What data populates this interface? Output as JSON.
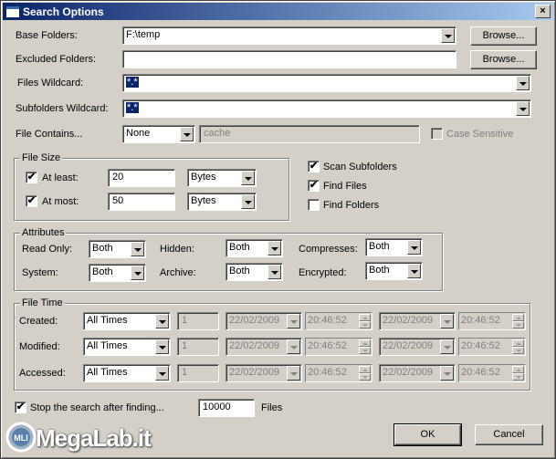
{
  "window": {
    "title": "Search Options",
    "close_glyph": "×"
  },
  "base_folders": {
    "label": "Base Folders:",
    "value": "F:\\temp",
    "browse": "Browse..."
  },
  "excluded_folders": {
    "label": "Excluded Folders:",
    "value": "",
    "browse": "Browse..."
  },
  "files_wildcard": {
    "label": "Files Wildcard:",
    "value": "*.*"
  },
  "subfolders_wildcard": {
    "label": "Subfolders Wildcard:",
    "value": "*.*"
  },
  "file_contains": {
    "label": "File Contains...",
    "mode": "None",
    "text": "cache",
    "case_sensitive": "Case Sensitive"
  },
  "file_size": {
    "title": "File Size",
    "at_least": {
      "label": "At least:",
      "value": "20",
      "unit": "Bytes",
      "checked": true
    },
    "at_most": {
      "label": "At most:",
      "value": "50",
      "unit": "Bytes",
      "checked": true
    }
  },
  "options": {
    "scan_subfolders": {
      "label": "Scan Subfolders",
      "checked": true
    },
    "find_files": {
      "label": "Find Files",
      "checked": true
    },
    "find_folders": {
      "label": "Find Folders",
      "checked": false
    }
  },
  "attributes": {
    "title": "Attributes",
    "read_only": {
      "label": "Read Only:",
      "value": "Both"
    },
    "hidden": {
      "label": "Hidden:",
      "value": "Both"
    },
    "compresses": {
      "label": "Compresses:",
      "value": "Both"
    },
    "system": {
      "label": "System:",
      "value": "Both"
    },
    "archive": {
      "label": "Archive:",
      "value": "Both"
    },
    "encrypted": {
      "label": "Encrypted:",
      "value": "Both"
    }
  },
  "file_time": {
    "title": "File Time",
    "rows": [
      {
        "label": "Created:",
        "mode": "All Times",
        "num": "1",
        "date1": "22/02/2009",
        "time1": "20:46:52",
        "date2": "22/02/2009",
        "time2": "20:46:52"
      },
      {
        "label": "Modified:",
        "mode": "All Times",
        "num": "1",
        "date1": "22/02/2009",
        "time1": "20:46:52",
        "date2": "22/02/2009",
        "time2": "20:46:52"
      },
      {
        "label": "Accessed:",
        "mode": "All Times",
        "num": "1",
        "date1": "22/02/2009",
        "time1": "20:46:52",
        "date2": "22/02/2009",
        "time2": "20:46:52"
      }
    ]
  },
  "stop_search": {
    "label": "Stop the search after finding...",
    "value": "10000",
    "suffix": "Files",
    "checked": true
  },
  "buttons": {
    "ok": "OK",
    "cancel": "Cancel"
  },
  "watermark": {
    "text": "MegaLab.it",
    "badge": "MLI"
  },
  "check_glyph": "✔"
}
